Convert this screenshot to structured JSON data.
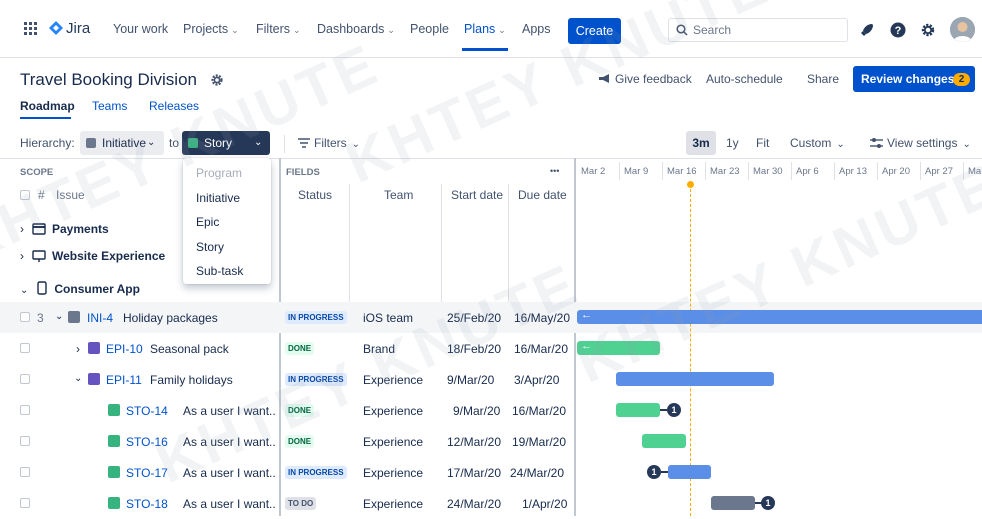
{
  "nav": {
    "logo_text": "Jira",
    "items": [
      {
        "label": "Your work"
      },
      {
        "label": "Projects"
      },
      {
        "label": "Filters"
      },
      {
        "label": "Dashboards"
      },
      {
        "label": "People"
      },
      {
        "label": "Plans"
      },
      {
        "label": "Apps"
      }
    ],
    "create_label": "Create",
    "search_placeholder": "Search"
  },
  "header": {
    "title": "Travel Booking Division",
    "tabs": [
      {
        "label": "Roadmap"
      },
      {
        "label": "Teams"
      },
      {
        "label": "Releases"
      }
    ],
    "give_feedback": "Give feedback",
    "auto_schedule": "Auto-schedule",
    "share": "Share",
    "review_changes": "Review changes",
    "review_count": "2"
  },
  "toolbar": {
    "hierarchy_label": "Hierarchy:",
    "from_level": "Initiative",
    "to_label": "to",
    "to_level": "Story",
    "filters": "Filters",
    "zoom": [
      "3m",
      "1y",
      "Fit"
    ],
    "custom": "Custom",
    "view_settings": "View settings"
  },
  "dropdown": {
    "items": [
      {
        "label": "Program",
        "disabled": true
      },
      {
        "label": "Initiative"
      },
      {
        "label": "Epic"
      },
      {
        "label": "Story"
      },
      {
        "label": "Sub-task"
      }
    ]
  },
  "table": {
    "scope_header": "SCOPE",
    "hash": "#",
    "issue_header": "Issue",
    "fields_header": "FIELDS",
    "more": "•••",
    "columns": [
      "Status",
      "Team",
      "Start date",
      "Due date"
    ],
    "groups": [
      {
        "label": "Payments"
      },
      {
        "label": "Website Experience"
      },
      {
        "label": "Consumer App"
      }
    ],
    "rows": [
      {
        "num": "3",
        "key": "INI-4",
        "summary": "Holiday packages",
        "status": "IN PROGRESS",
        "team": "iOS team",
        "start": "25/Feb/20",
        "due": "16/May/20"
      },
      {
        "key": "EPI-10",
        "summary": "Seasonal pack",
        "status": "DONE",
        "team": "Brand",
        "start": "18/Feb/20",
        "due": "16/Mar/20"
      },
      {
        "key": "EPI-11",
        "summary": "Family holidays",
        "status": "IN PROGRESS",
        "team": "Experience",
        "start": "9/Mar/20",
        "due": "3/Apr/20"
      },
      {
        "key": "STO-14",
        "summary": "As a user I want..",
        "status": "DONE",
        "team": "Experience",
        "start": "9/Mar/20",
        "due": "16/Mar/20",
        "badge": "1"
      },
      {
        "key": "STO-16",
        "summary": "As a user I want..",
        "status": "DONE",
        "team": "Experience",
        "start": "12/Mar/20",
        "due": "19/Mar/20"
      },
      {
        "key": "STO-17",
        "summary": "As a user I want..",
        "status": "IN PROGRESS",
        "team": "Experience",
        "start": "17/Mar/20",
        "due": "24/Mar/20",
        "badge": "1"
      },
      {
        "key": "STO-18",
        "summary": "As a user I want..",
        "status": "TO DO",
        "team": "Experience",
        "start": "24/Mar/20",
        "due": "1/Apr/20",
        "badge": "1"
      }
    ]
  },
  "timeline": {
    "dates": [
      "Mar 2",
      "Mar 9",
      "Mar 16",
      "Mar 23",
      "Mar 30",
      "Apr 6",
      "Apr 13",
      "Apr 20",
      "Apr 27",
      "Ma"
    ]
  },
  "watermark": "KHTEY KNUTE",
  "colors": {
    "primary": "#0052cc",
    "bar_blue": "#5b8ee6",
    "bar_green": "#4fd191",
    "bar_grey": "#6b778c",
    "today": "#ffab00"
  }
}
